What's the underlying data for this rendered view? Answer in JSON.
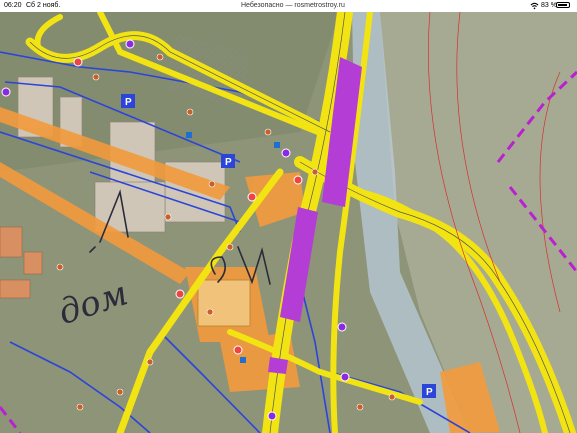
{
  "status_bar": {
    "time": "06:20",
    "date": "Сб 2 нояб.",
    "url": "Небезопасно — rosmetrostroy.ru",
    "battery": "83 %"
  },
  "map": {
    "handwritten_annotation": "дом",
    "icons": [
      "parking-icon",
      "bus-stop-icon",
      "metro-icon",
      "pedestrian-crossing-icon"
    ],
    "colors": {
      "yellow_road": "#f2e312",
      "orange_zone": "#f39a3c",
      "purple_station": "#b43dd6",
      "blue_lines": "#2a45d8",
      "magenta_boundary": "#b820d0"
    }
  }
}
